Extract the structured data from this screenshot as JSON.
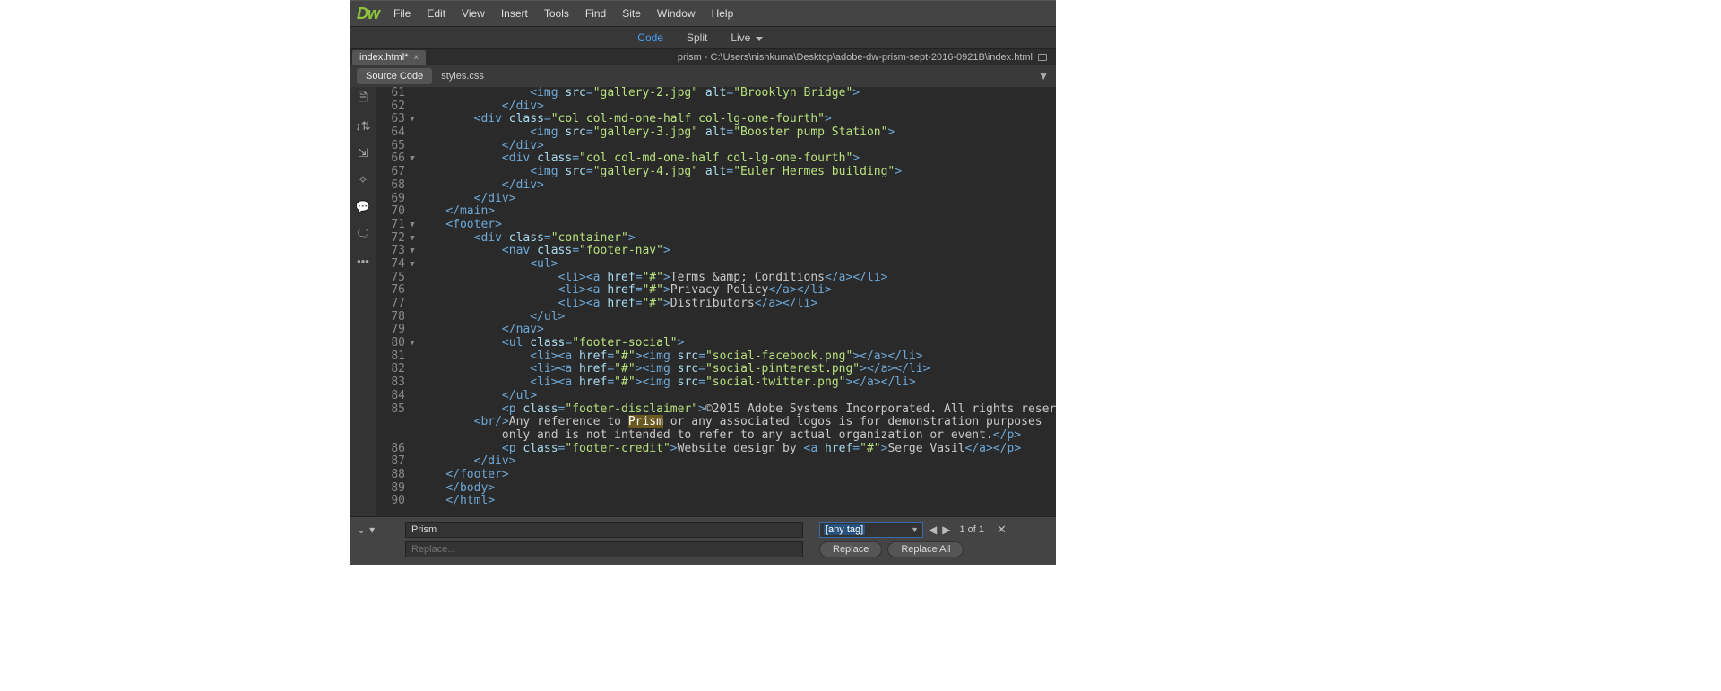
{
  "menu": {
    "logo": "Dw",
    "items": [
      "File",
      "Edit",
      "View",
      "Insert",
      "Tools",
      "Find",
      "Site",
      "Window",
      "Help"
    ]
  },
  "view_modes": {
    "code": "Code",
    "split": "Split",
    "live": "Live"
  },
  "tab": {
    "filename": "index.html*",
    "path": "prism - C:\\Users\\nishkuma\\Desktop\\adobe-dw-prism-sept-2016-0921B\\index.html"
  },
  "subtabs": {
    "source": "Source Code",
    "styles": "styles.css"
  },
  "code_lines": [
    {
      "n": 61,
      "f": "",
      "c": "                <span class='tag'>&lt;img</span> <span class='attr'>src</span><span class='tag'>=</span><span class='str'>\"gallery-2.jpg\"</span> <span class='attr'>alt</span><span class='tag'>=</span><span class='str'>\"Brooklyn Bridge\"</span><span class='tag'>&gt;</span>"
    },
    {
      "n": 62,
      "f": "",
      "c": "            <span class='tag'>&lt;/div&gt;</span>"
    },
    {
      "n": 63,
      "f": "▼",
      "c": "        <span class='tag'>&lt;div</span> <span class='attr'>class</span><span class='tag'>=</span><span class='str'>\"col col-md-one-half col-lg-one-fourth\"</span><span class='tag'>&gt;</span>"
    },
    {
      "n": 64,
      "f": "",
      "c": "                <span class='tag'>&lt;img</span> <span class='attr'>src</span><span class='tag'>=</span><span class='str'>\"gallery-3.jpg\"</span> <span class='attr'>alt</span><span class='tag'>=</span><span class='str'>\"Booster pump Station\"</span><span class='tag'>&gt;</span>"
    },
    {
      "n": 65,
      "f": "",
      "c": "            <span class='tag'>&lt;/div&gt;</span>"
    },
    {
      "n": 66,
      "f": "▼",
      "c": "            <span class='tag'>&lt;div</span> <span class='attr'>class</span><span class='tag'>=</span><span class='str'>\"col col-md-one-half col-lg-one-fourth\"</span><span class='tag'>&gt;</span>"
    },
    {
      "n": 67,
      "f": "",
      "c": "                <span class='tag'>&lt;img</span> <span class='attr'>src</span><span class='tag'>=</span><span class='str'>\"gallery-4.jpg\"</span> <span class='attr'>alt</span><span class='tag'>=</span><span class='str'>\"Euler Hermes building\"</span><span class='tag'>&gt;</span>"
    },
    {
      "n": 68,
      "f": "",
      "c": "            <span class='tag'>&lt;/div&gt;</span>"
    },
    {
      "n": 69,
      "f": "",
      "c": "        <span class='tag'>&lt;/div&gt;</span>"
    },
    {
      "n": 70,
      "f": "",
      "c": "    <span class='tag'>&lt;/main&gt;</span>"
    },
    {
      "n": 71,
      "f": "▼",
      "c": "    <span class='tag'>&lt;footer&gt;</span>"
    },
    {
      "n": 72,
      "f": "▼",
      "c": "        <span class='tag'>&lt;div</span> <span class='attr'>class</span><span class='tag'>=</span><span class='str'>\"container\"</span><span class='tag'>&gt;</span>"
    },
    {
      "n": 73,
      "f": "▼",
      "c": "            <span class='tag'>&lt;nav</span> <span class='attr'>class</span><span class='tag'>=</span><span class='str'>\"footer-nav\"</span><span class='tag'>&gt;</span>"
    },
    {
      "n": 74,
      "f": "▼",
      "c": "                <span class='tag'>&lt;ul&gt;</span>"
    },
    {
      "n": 75,
      "f": "",
      "c": "                    <span class='tag'>&lt;li&gt;&lt;a</span> <span class='attr'>href</span><span class='tag'>=</span><span class='str'>\"#\"</span><span class='tag'>&gt;</span><span class='txt'>Terms </span><span class='entity'>&amp;amp;</span><span class='txt'> Conditions</span><span class='tag'>&lt;/a&gt;&lt;/li&gt;</span>"
    },
    {
      "n": 76,
      "f": "",
      "c": "                    <span class='tag'>&lt;li&gt;&lt;a</span> <span class='attr'>href</span><span class='tag'>=</span><span class='str'>\"#\"</span><span class='tag'>&gt;</span><span class='txt'>Privacy Policy</span><span class='tag'>&lt;/a&gt;&lt;/li&gt;</span>"
    },
    {
      "n": 77,
      "f": "",
      "c": "                    <span class='tag'>&lt;li&gt;&lt;a</span> <span class='attr'>href</span><span class='tag'>=</span><span class='str'>\"#\"</span><span class='tag'>&gt;</span><span class='txt'>Distributors</span><span class='tag'>&lt;/a&gt;&lt;/li&gt;</span>"
    },
    {
      "n": 78,
      "f": "",
      "c": "                <span class='tag'>&lt;/ul&gt;</span>"
    },
    {
      "n": 79,
      "f": "",
      "c": "            <span class='tag'>&lt;/nav&gt;</span>"
    },
    {
      "n": 80,
      "f": "▼",
      "c": "            <span class='tag'>&lt;ul</span> <span class='attr'>class</span><span class='tag'>=</span><span class='str'>\"footer-social\"</span><span class='tag'>&gt;</span>"
    },
    {
      "n": 81,
      "f": "",
      "c": "                <span class='tag'>&lt;li&gt;&lt;a</span> <span class='attr'>href</span><span class='tag'>=</span><span class='str'>\"#\"</span><span class='tag'>&gt;&lt;img</span> <span class='attr'>src</span><span class='tag'>=</span><span class='str'>\"social-facebook.png\"</span><span class='tag'>&gt;&lt;/a&gt;&lt;/li&gt;</span>"
    },
    {
      "n": 82,
      "f": "",
      "c": "                <span class='tag'>&lt;li&gt;&lt;a</span> <span class='attr'>href</span><span class='tag'>=</span><span class='str'>\"#\"</span><span class='tag'>&gt;&lt;img</span> <span class='attr'>src</span><span class='tag'>=</span><span class='str'>\"social-pinterest.png\"</span><span class='tag'>&gt;&lt;/a&gt;&lt;/li&gt;</span>"
    },
    {
      "n": 83,
      "f": "",
      "c": "                <span class='tag'>&lt;li&gt;&lt;a</span> <span class='attr'>href</span><span class='tag'>=</span><span class='str'>\"#\"</span><span class='tag'>&gt;&lt;img</span> <span class='attr'>src</span><span class='tag'>=</span><span class='str'>\"social-twitter.png\"</span><span class='tag'>&gt;&lt;/a&gt;&lt;/li&gt;</span>"
    },
    {
      "n": 84,
      "f": "",
      "c": "            <span class='tag'>&lt;/ul&gt;</span>"
    },
    {
      "n": 85,
      "f": "",
      "c": "            <span class='tag'>&lt;p</span> <span class='attr'>class</span><span class='tag'>=</span><span class='str'>\"footer-disclaimer\"</span><span class='tag'>&gt;</span><span class='txt'>©2015 Adobe Systems Incorporated. All rights reserved.</span>"
    },
    {
      "n": "",
      "f": "",
      "c": "        <span class='tag'>&lt;br/&gt;</span><span class='txt'>Any reference to </span><span class='hl'>Prism</span><span class='txt'> or any associated logos is for demonstration purposes</span>"
    },
    {
      "n": "",
      "f": "",
      "c": "            <span class='txt'>only and is not intended to refer to any actual organization or event.</span><span class='tag'>&lt;/p&gt;</span>"
    },
    {
      "n": 86,
      "f": "",
      "c": "            <span class='tag'>&lt;p</span> <span class='attr'>class</span><span class='tag'>=</span><span class='str'>\"footer-credit\"</span><span class='tag'>&gt;</span><span class='txt'>Website design by </span><span class='tag'>&lt;a</span> <span class='attr'>href</span><span class='tag'>=</span><span class='str'>\"#\"</span><span class='tag'>&gt;</span><span class='txt'>Serge Vasil</span><span class='tag'>&lt;/a&gt;&lt;/p&gt;</span>"
    },
    {
      "n": 87,
      "f": "",
      "c": "        <span class='tag'>&lt;/div&gt;</span>"
    },
    {
      "n": 88,
      "f": "",
      "c": "    <span class='tag'>&lt;/footer&gt;</span>"
    },
    {
      "n": 89,
      "f": "",
      "c": "    <span class='tag'>&lt;/body&gt;</span>"
    },
    {
      "n": 90,
      "f": "",
      "c": "    <span class='tag'>&lt;/html&gt;</span>"
    }
  ],
  "search": {
    "find_value": "Prism",
    "replace_placeholder": "Replace...",
    "tag_select": "[any tag]",
    "count": "1 of 1",
    "replace_btn": "Replace",
    "replace_all_btn": "Replace All"
  }
}
